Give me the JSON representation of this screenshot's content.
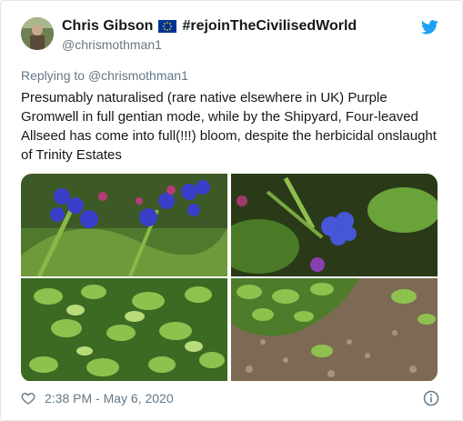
{
  "author": {
    "name": "Chris Gibson",
    "hashtag": "#rejoinTheCivilisedWorld",
    "handle": "@chrismothman1",
    "flag_icon": "eu-flag-icon"
  },
  "reply": {
    "prefix": "Replying to",
    "handle": "@chrismothman1"
  },
  "tweet": {
    "text": "Presumably naturalised (rare native elsewhere in UK) Purple Gromwell in full gentian mode, while by the Shipyard, Four-leaved Allseed has come into full(!!!) bloom, despite the herbicidal onslaught of Trinity Estates"
  },
  "media": {
    "photos": [
      {
        "subject": "purple-gromwell-flowers"
      },
      {
        "subject": "purple-gromwell-single-flower"
      },
      {
        "subject": "four-leaved-allseed-foliage"
      },
      {
        "subject": "four-leaved-allseed-on-gravel"
      }
    ]
  },
  "footer": {
    "timestamp": "2:38 PM - May 6, 2020"
  },
  "colors": {
    "twitter_blue": "#1da1f2",
    "secondary_text": "#657786",
    "border": "#e1e8ed"
  }
}
